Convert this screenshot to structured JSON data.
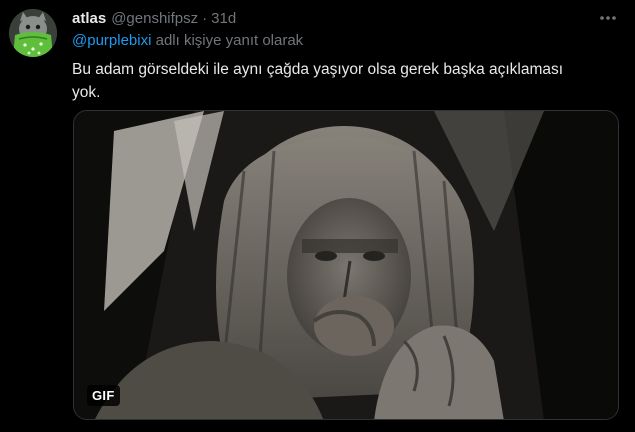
{
  "tweet": {
    "display_name": "atlas",
    "handle": "@genshifpsz",
    "separator": "·",
    "time": "31d",
    "reply_mention": "@purplebixi",
    "reply_suffix": " adlı kişiye yanıt olarak",
    "text": "Bu adam görseldeki ile aynı çağda yaşıyor olsa gerek başka açıklaması yok.",
    "media_badge": "GIF"
  },
  "icons": {
    "avatar": "bandana-avatar-icon",
    "more": "more-dots-icon"
  },
  "colors": {
    "background": "#000000",
    "text_primary": "#e7e9ea",
    "text_secondary": "#71767b",
    "link": "#1d9bf0",
    "border": "#2f3336"
  }
}
